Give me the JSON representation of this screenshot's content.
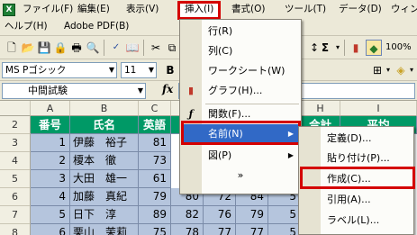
{
  "menubar": {
    "row1": [
      {
        "id": "file",
        "label": "ファイル(F)"
      },
      {
        "id": "edit",
        "label": "編集(E)"
      },
      {
        "id": "view",
        "label": "表示(V)"
      },
      {
        "id": "insert",
        "label": "挿入(I)"
      },
      {
        "id": "format",
        "label": "書式(O)"
      },
      {
        "id": "tools",
        "label": "ツール(T)"
      },
      {
        "id": "data",
        "label": "データ(D)"
      },
      {
        "id": "window",
        "label": "ウィン"
      }
    ],
    "row2": [
      {
        "id": "help",
        "label": "ヘルプ(H)"
      },
      {
        "id": "adobe",
        "label": "Adobe PDF(B)"
      }
    ]
  },
  "toolbar": {
    "zoom": "100%",
    "sigma": "Σ"
  },
  "format_toolbar": {
    "font_name": "MS Pゴシック",
    "font_size": "11",
    "bold": "B"
  },
  "formula_bar": {
    "name_box": "中間試験",
    "fx": "fx",
    "formula": ""
  },
  "grid": {
    "columns": [
      "A",
      "B",
      "C",
      "D",
      "E",
      "F",
      "G",
      "H",
      "I"
    ],
    "rows": [
      "2",
      "3",
      "4",
      "5",
      "6",
      "7",
      "8"
    ],
    "header_row": [
      "番号",
      "氏名",
      "英語",
      "",
      "",
      "",
      "",
      "合計",
      "平均"
    ],
    "data": [
      {
        "no": "1",
        "name": "伊藤　裕子",
        "score": "81",
        "extra": []
      },
      {
        "no": "2",
        "name": "榎本　徹",
        "score": "73",
        "extra": []
      },
      {
        "no": "3",
        "name": "大田　雄一",
        "score": "61",
        "extra": []
      },
      {
        "no": "4",
        "name": "加藤　真紀",
        "score": "79",
        "extra": [
          "80",
          "72",
          "84",
          "5"
        ]
      },
      {
        "no": "5",
        "name": "日下　淳",
        "score": "89",
        "extra": [
          "82",
          "76",
          "79",
          "5"
        ]
      },
      {
        "no": "6",
        "name": "栗山　茉莉",
        "score": "75",
        "extra": [
          "78",
          "77",
          "77",
          "5"
        ]
      }
    ]
  },
  "insert_menu": {
    "items": [
      {
        "label": "行(R)"
      },
      {
        "label": "列(C)"
      },
      {
        "label": "ワークシート(W)"
      },
      {
        "label": "グラフ(H)..."
      },
      {
        "label": "関数(F)..."
      },
      {
        "label": "名前(N)"
      },
      {
        "label": "図(P)"
      },
      {
        "label": "»"
      }
    ]
  },
  "name_submenu": {
    "items": [
      {
        "label": "定義(D)..."
      },
      {
        "label": "貼り付け(P)..."
      },
      {
        "label": "作成(C)..."
      },
      {
        "label": "引用(A)..."
      },
      {
        "label": "ラベル(L)..."
      }
    ]
  },
  "colors": {
    "highlight": "#d40000",
    "selection": "#3169c6",
    "header_fill": "#009966",
    "cell_fill": "#b5c5dd"
  }
}
